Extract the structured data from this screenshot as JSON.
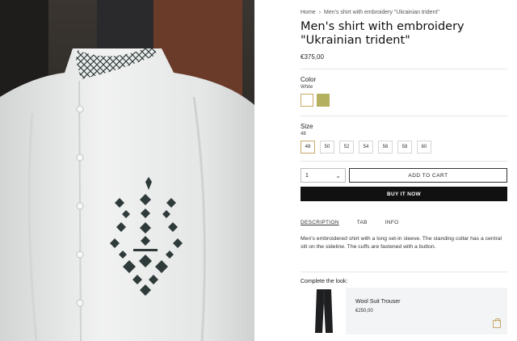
{
  "breadcrumb": {
    "home": "Home",
    "separator": "›",
    "current": "Men's shirt with embroidery \"Ukrainian trident\""
  },
  "product": {
    "title": "Men's shirt with embroidery \"Ukrainian trident\"",
    "price": "€375,00"
  },
  "color": {
    "label": "Color",
    "selected": "White",
    "swatches": [
      {
        "name": "White",
        "hex": "#ffffff"
      },
      {
        "name": "Olive",
        "hex": "#b3b060"
      }
    ]
  },
  "size": {
    "label": "Size",
    "selected": "48",
    "options": [
      "48",
      "50",
      "52",
      "54",
      "56",
      "58",
      "60"
    ]
  },
  "quantity": {
    "value": "1"
  },
  "buttons": {
    "add_to_cart": "ADD TO CART",
    "buy_now": "BUY IT NOW"
  },
  "tabs": [
    "DESCRIPTION",
    "TAB",
    "INFO"
  ],
  "description": "Men's embroidered shirt with a long set-in sleeve. The standing collar has a central slit on the sideline. The cuffs are fastened with a button.",
  "complete_look": {
    "label": "Complete the look:",
    "item": {
      "name": "Wool Suit Trouser",
      "price": "€250,00"
    }
  },
  "colors": {
    "accent": "#c9a86a",
    "dark": "#111111",
    "card_bg": "#f3f4f6"
  }
}
